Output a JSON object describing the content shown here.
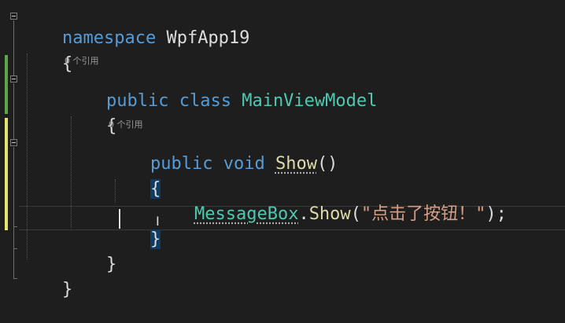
{
  "code": {
    "namespace_keyword": "namespace",
    "namespace_name": "WpfApp19",
    "open_brace_1": "{",
    "ref_count_1": "0 个引用",
    "class_public": "public",
    "class_keyword": "class",
    "class_name": "MainViewModel",
    "open_brace_2": "{",
    "ref_count_2": "0 个引用",
    "method_public": "public",
    "method_void": "void",
    "method_name": "Show",
    "method_parens": "()",
    "open_brace_3": "{",
    "call_type": "MessageBox",
    "call_dot": ".",
    "call_method": "Show",
    "call_open": "(",
    "call_string": "\"点击了按钮！\"",
    "call_close": ");",
    "close_brace_3": "}",
    "close_brace_2": "}",
    "close_brace_1": "}"
  },
  "colors": {
    "background": "#1e1e1e",
    "keyword": "#569cd6",
    "type": "#4ec9b0",
    "method": "#dcdcaa",
    "string": "#d69d85",
    "text": "#dcdcdc",
    "change_bar_saved": "#57a64a",
    "change_bar_unsaved": "#e6e36a"
  },
  "icons": {
    "fold_marker": "collapse-box-icon",
    "text_cursor": "ibeam-cursor-icon"
  }
}
